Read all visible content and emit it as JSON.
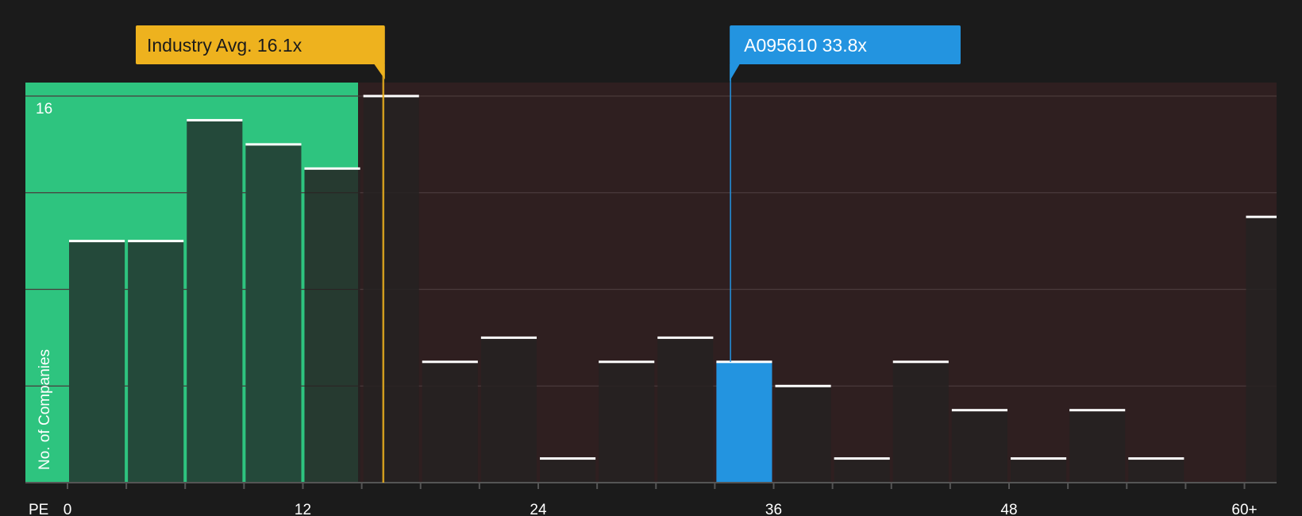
{
  "chart_data": {
    "type": "bar",
    "x_axis_label": "PE",
    "y_axis_label": "No. of Companies",
    "x_ticks": [
      "0",
      "12",
      "24",
      "36",
      "48",
      "60+"
    ],
    "y_tick_labels": [
      "16"
    ],
    "ylim": [
      0,
      16
    ],
    "bin_width": 3,
    "bins": [
      {
        "start": 0,
        "value": 10
      },
      {
        "start": 3,
        "value": 10
      },
      {
        "start": 6,
        "value": 15
      },
      {
        "start": 9,
        "value": 14
      },
      {
        "start": 12,
        "value": 13
      },
      {
        "start": 15,
        "value": 16
      },
      {
        "start": 18,
        "value": 5
      },
      {
        "start": 21,
        "value": 6
      },
      {
        "start": 24,
        "value": 1
      },
      {
        "start": 27,
        "value": 5
      },
      {
        "start": 30,
        "value": 6
      },
      {
        "start": 33,
        "value": 5,
        "highlight": true
      },
      {
        "start": 36,
        "value": 4
      },
      {
        "start": 39,
        "value": 1
      },
      {
        "start": 42,
        "value": 5
      },
      {
        "start": 45,
        "value": 3
      },
      {
        "start": 48,
        "value": 1
      },
      {
        "start": 51,
        "value": 3
      },
      {
        "start": 54,
        "value": 1
      },
      {
        "start": 60,
        "value": 11
      }
    ],
    "industry_avg": {
      "label": "Industry Avg. 16.1x",
      "value": 16.1
    },
    "company": {
      "label": "A095610 33.8x",
      "value": 33.8
    },
    "colors": {
      "background": "#1b1b1b",
      "undervalued_zone": "#2ec47f",
      "overvalued_zone": "#2f1f20",
      "bar_in_green": "#24493a",
      "bar_dark": "#242222",
      "bar_top": "#ffffff",
      "highlight_bar": "#2394e0",
      "industry_avg": "#eeb21e",
      "company": "#2394e0",
      "gridline": "#4a3a3b",
      "axis": "#555555"
    }
  }
}
